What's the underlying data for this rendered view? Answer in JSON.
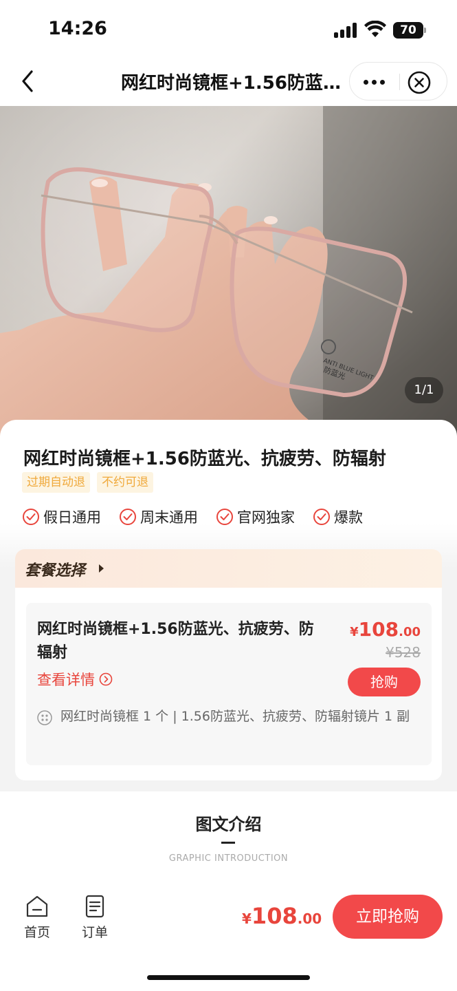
{
  "status_bar": {
    "time": "14:26",
    "battery": "70"
  },
  "nav": {
    "title": "网红时尚镜框+1.56防蓝光、抗疲劳、防辐射"
  },
  "hero": {
    "image_counter": "1/1",
    "lens_print_1": "ANTI BLUE LIGHT",
    "lens_print_2": "防蓝光"
  },
  "product": {
    "title": "网红时尚镜框+1.56防蓝光、抗疲劳、防辐射",
    "tags": [
      "过期自动退",
      "不约可退"
    ],
    "features": [
      "假日通用",
      "周末通用",
      "官网独家",
      "爆款"
    ]
  },
  "package": {
    "header": "套餐选择",
    "name": "网红时尚镜框+1.56防蓝光、抗疲劳、防辐射",
    "details_link": "查看详情",
    "price_currency": "¥",
    "price_int": "108",
    "price_dec": ".00",
    "original_price": "¥528",
    "buy_label": "抢购",
    "description": "网红时尚镜框 1 个 | 1.56防蓝光、抗疲劳、防辐射镜片 1 副"
  },
  "intro": {
    "title": "图文介绍",
    "subtitle": "GRAPHIC INTRODUCTION"
  },
  "bottom_bar": {
    "home_label": "首页",
    "orders_label": "订单",
    "price_currency": "¥",
    "price_int": "108",
    "price_dec": ".00",
    "buy_now_label": "立即抢购"
  },
  "colors": {
    "accent": "#f2494a",
    "price": "#e8453c",
    "tag_bg": "#fdf4e1",
    "tag_text": "#f0a93b"
  }
}
